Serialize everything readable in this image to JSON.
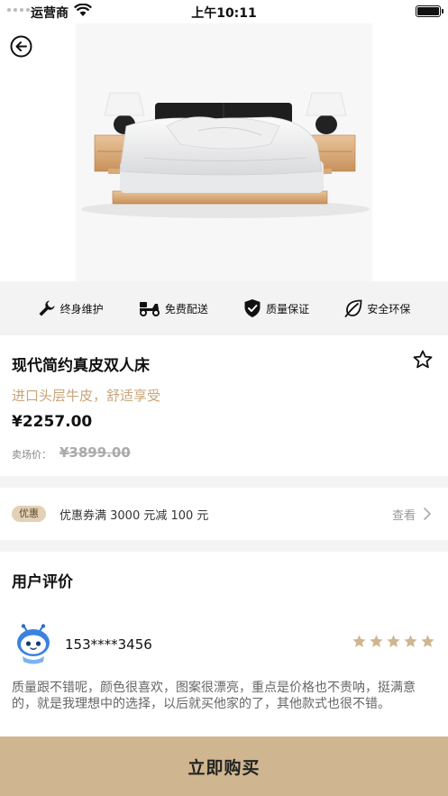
{
  "status_bar": {
    "carrier": "运营商",
    "time": "上午10:11"
  },
  "features": [
    {
      "label": "终身维护",
      "icon": "wrench-icon"
    },
    {
      "label": "免费配送",
      "icon": "scooter-icon"
    },
    {
      "label": "质量保证",
      "icon": "shield-check-icon"
    },
    {
      "label": "安全环保",
      "icon": "leaf-icon"
    }
  ],
  "product": {
    "title": "现代简约真皮双人床",
    "subtitle": "进口头层牛皮，舒适享受",
    "price": "¥2257.00",
    "market_label": "卖场价：",
    "market_price": "¥3899.00"
  },
  "coupon": {
    "badge": "优惠",
    "text": "优惠券满 3000 元减 100 元",
    "view": "查看"
  },
  "reviews": {
    "title": "用户评价",
    "items": [
      {
        "user": "153****3456",
        "rating": 5,
        "text": "质量跟不错呢，颜色很喜欢，图案很漂亮，重点是价格也不贵呐，挺满意的，就是我理想中的选择，以后就买他家的了，其他款式也很不错。"
      }
    ]
  },
  "actions": {
    "buy": "立即购买"
  },
  "colors": {
    "accent": "#cfb690",
    "subtitle": "#c8a57a",
    "badge_bg": "#e3d1b5",
    "star": "#cfb690"
  }
}
